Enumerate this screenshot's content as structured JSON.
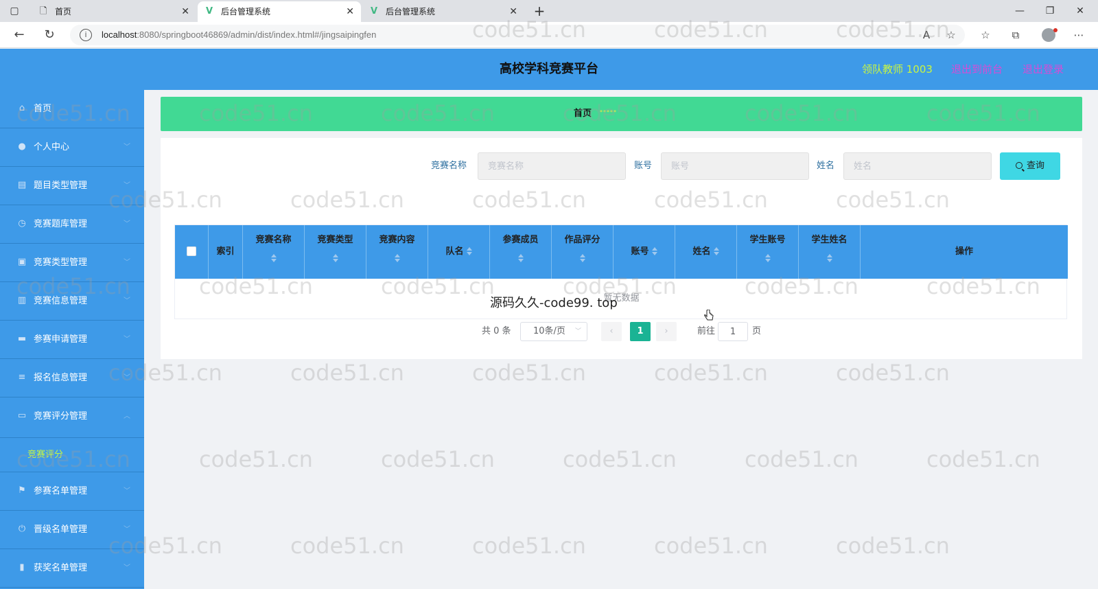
{
  "browser": {
    "tabs": [
      {
        "label": "首页"
      },
      {
        "label": "后台管理系统"
      },
      {
        "label": "后台管理系统"
      }
    ],
    "new_tab_icon": "plus-icon",
    "url_host": "localhost",
    "url_rest": ":8080/springboot46869/admin/dist/index.html#/jingsaipingfen"
  },
  "header": {
    "title": "高校学科竞赛平台",
    "user": "领队教师 1003",
    "link_front": "退出到前台",
    "link_logout": "退出登录",
    "colors": {
      "bar": "#3e9ae8",
      "user": "#c8f542",
      "link": "#d64cd6"
    }
  },
  "sidebar": {
    "items": [
      {
        "label": "首页",
        "icon": "home-icon",
        "arrow": false
      },
      {
        "label": "个人中心",
        "icon": "user-icon",
        "arrow": true
      },
      {
        "label": "题目类型管理",
        "icon": "list-icon",
        "arrow": true
      },
      {
        "label": "竞赛题库管理",
        "icon": "clock-icon",
        "arrow": true
      },
      {
        "label": "竞赛类型管理",
        "icon": "doc-icon",
        "arrow": true
      },
      {
        "label": "竞赛信息管理",
        "icon": "chart-icon",
        "arrow": true
      },
      {
        "label": "参赛申请管理",
        "icon": "briefcase-icon",
        "arrow": true
      },
      {
        "label": "报名信息管理",
        "icon": "menu-icon",
        "arrow": true
      },
      {
        "label": "竞赛评分管理",
        "icon": "card-icon",
        "arrow": true,
        "expanded": true
      },
      {
        "label": "参赛名单管理",
        "icon": "flag-icon",
        "arrow": true
      },
      {
        "label": "晋级名单管理",
        "icon": "power-icon",
        "arrow": true
      },
      {
        "label": "获奖名单管理",
        "icon": "bar-icon",
        "arrow": true
      }
    ],
    "active_sub": "竞赛评分"
  },
  "breadcrumb": {
    "home": "首页",
    "sep": "*****"
  },
  "search": {
    "label1": "竞赛名称",
    "placeholder1": "竞赛名称",
    "label2": "账号",
    "placeholder2": "账号",
    "label3": "姓名",
    "placeholder3": "姓名",
    "button": "查询"
  },
  "table": {
    "columns": [
      "索引",
      "竞赛名称",
      "竞赛类型",
      "竞赛内容",
      "队名",
      "参赛成员",
      "作品评分",
      "账号",
      "姓名",
      "学生账号",
      "学生姓名",
      "操作"
    ],
    "empty": "暂无数据"
  },
  "pagination": {
    "total": "共 0 条",
    "page_size": "10条/页",
    "current_page": "1",
    "goto_label": "前往",
    "goto_value": "1",
    "page_suffix": "页"
  },
  "overlay": "源码久久-code99. top",
  "watermark": "code51.cn"
}
